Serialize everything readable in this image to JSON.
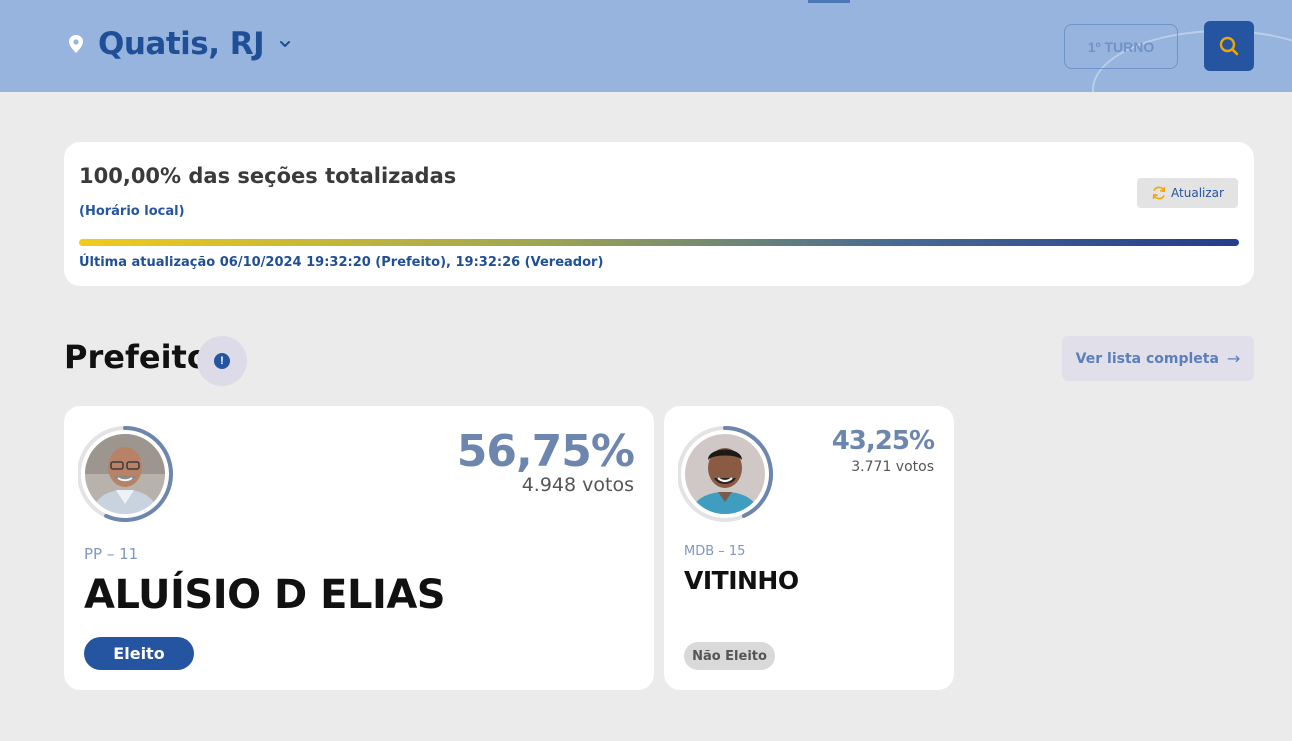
{
  "header": {
    "location": "Quatis, RJ",
    "turn_label": "1º TURNO"
  },
  "status": {
    "title": "100,00% das seções totalizadas",
    "local_time_note": "(Horário local)",
    "refresh_label": "Atualizar",
    "progress_percent": 100,
    "last_update": "Última atualização 06/10/2024 19:32:20 (Prefeito), 19:32:26 (Vereador)"
  },
  "section": {
    "title": "Prefeito",
    "info_glyph": "!",
    "full_list_label": "Ver lista completa",
    "full_list_arrow": "→"
  },
  "candidates": [
    {
      "party": "PP – 11",
      "name": "ALUÍSIO D ELIAS",
      "percent": "56,75%",
      "percent_value": 56.75,
      "votes": "4.948 votos",
      "status": "Eleito"
    },
    {
      "party": "MDB – 15",
      "name": "VITINHO",
      "percent": "43,25%",
      "percent_value": 43.25,
      "votes": "3.771 votos",
      "status": "Não Eleito"
    }
  ],
  "colors": {
    "header_bg": "#97b4de",
    "brand_blue": "#2555a0",
    "percent_text": "#6d86ad",
    "accent_orange": "#f0a500"
  },
  "icons": {
    "location": "map-pin-icon",
    "dropdown": "chevron-down-icon",
    "search": "search-icon",
    "refresh": "refresh-icon",
    "info": "info-icon",
    "arrow": "arrow-right-icon"
  }
}
